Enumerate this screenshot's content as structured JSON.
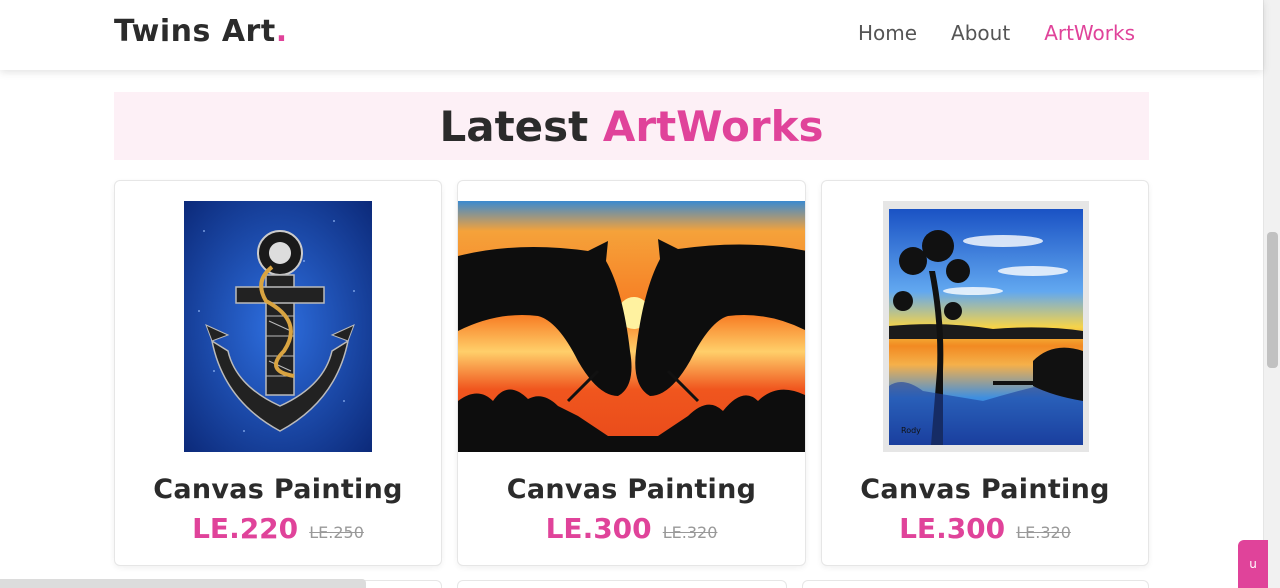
{
  "header": {
    "logo_text": "Twins Art",
    "logo_dot": ".",
    "nav": [
      {
        "label": "Home"
      },
      {
        "label": "About"
      },
      {
        "label": "ArtWorks",
        "active": true
      }
    ]
  },
  "section": {
    "title_main": "Latest",
    "title_accent": "ArtWorks"
  },
  "products": [
    {
      "title": "Canvas Painting",
      "price": "LE.220",
      "old_price": "LE.250",
      "image": "anchor-painting"
    },
    {
      "title": "Canvas Painting",
      "price": "LE.300",
      "old_price": "LE.320",
      "image": "horses-sunset-painting"
    },
    {
      "title": "Canvas Painting",
      "price": "LE.300",
      "old_price": "LE.320",
      "image": "lake-sunset-painting"
    }
  ],
  "side_tab": {
    "label": "u"
  },
  "colors": {
    "accent": "#e0439a",
    "text": "#2b2b2b",
    "band": "#fdf0f6"
  }
}
